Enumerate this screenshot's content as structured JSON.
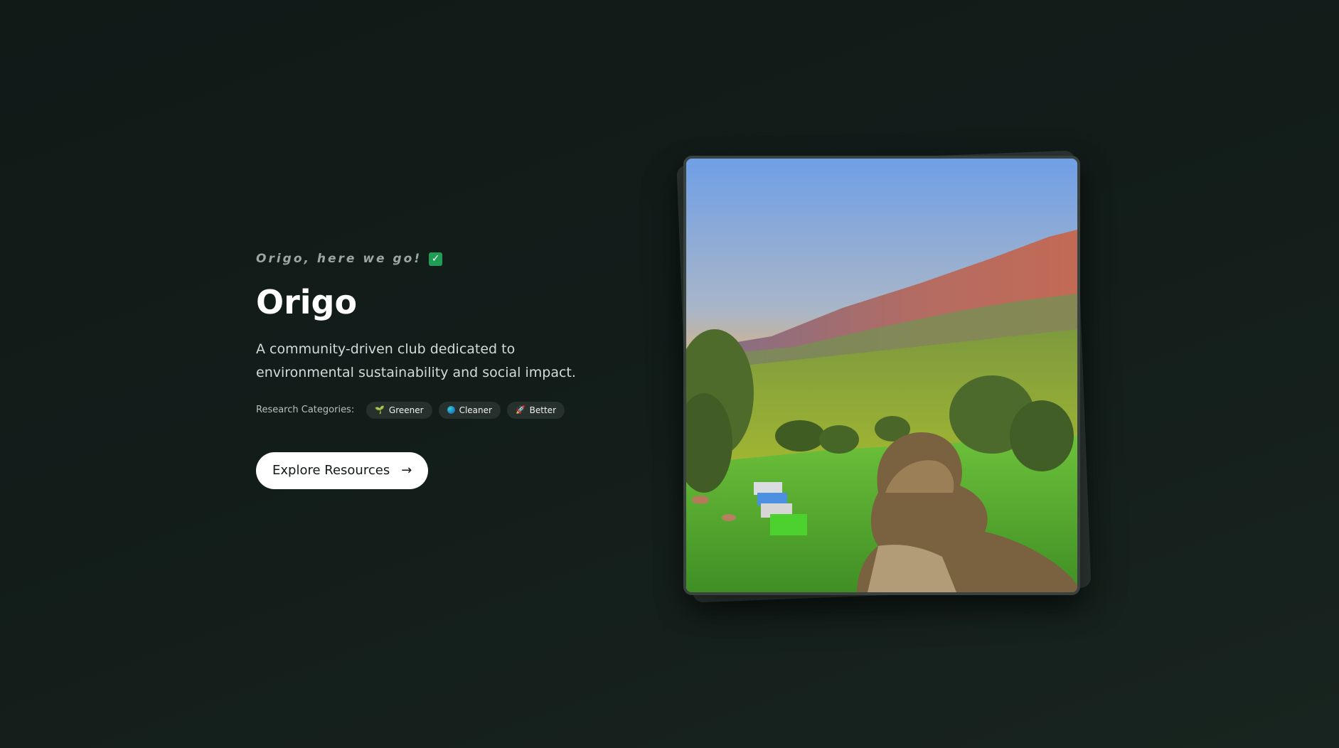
{
  "hero": {
    "tagline": "Origo, here we go!",
    "tagline_icon": "check-mark-icon",
    "title": "Origo",
    "description": "A community-driven club dedicated to environmental sustainability and social impact.",
    "categories_label": "Research Categories:",
    "categories": [
      {
        "label": "Greener",
        "icon": "sprout-icon"
      },
      {
        "label": "Cleaner",
        "icon": "globe-icon"
      },
      {
        "label": "Better",
        "icon": "rocket-icon"
      }
    ],
    "cta_label": "Explore Resources",
    "cta_icon": "arrow-right-icon"
  },
  "colors": {
    "background": "#121c19",
    "accent_check": "#1f9d55",
    "button_bg": "#ffffff",
    "chip_bg": "#26302d"
  }
}
